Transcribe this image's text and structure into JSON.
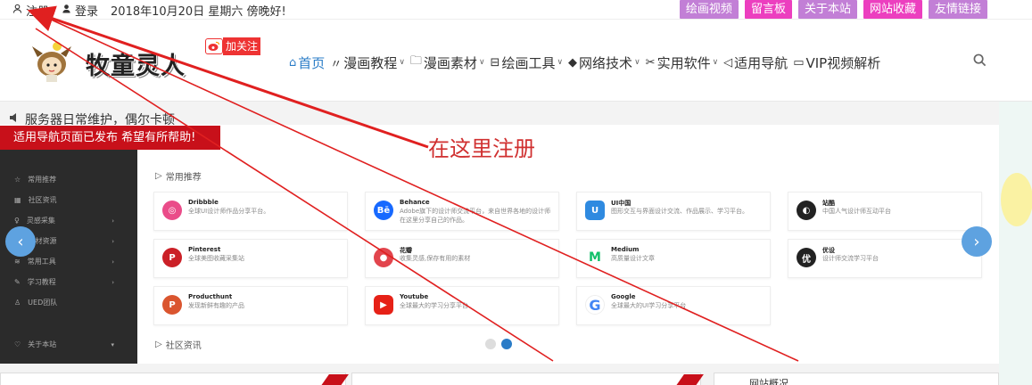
{
  "topbar": {
    "register": "注册",
    "login": "登录",
    "date": "2018年10月20日 星期六 傍晚好!",
    "links": [
      {
        "label": "绘画视频",
        "color": "#c27fd6"
      },
      {
        "label": "留言板",
        "color": "#ec3fbf"
      },
      {
        "label": "关于本站",
        "color": "#c27fd6"
      },
      {
        "label": "网站收藏",
        "color": "#ec3fbf"
      },
      {
        "label": "友情链接",
        "color": "#c27fd6"
      }
    ]
  },
  "header": {
    "logo_text": "牧童灵人",
    "weibo_follow": "加关注",
    "nav": [
      {
        "label": "首页",
        "icon": "home-icon",
        "dropdown": false,
        "active": true
      },
      {
        "label": "漫画教程",
        "icon": "brush-icon",
        "dropdown": true,
        "active": false
      },
      {
        "label": "漫画素材",
        "icon": "folder-icon",
        "dropdown": true,
        "active": false
      },
      {
        "label": "绘画工具",
        "icon": "briefcase-icon",
        "dropdown": true,
        "active": false
      },
      {
        "label": "网络技术",
        "icon": "graduation-cap-icon",
        "dropdown": true,
        "active": false
      },
      {
        "label": "实用软件",
        "icon": "scissors-icon",
        "dropdown": true,
        "active": false
      },
      {
        "label": "适用导航",
        "icon": "send-icon",
        "dropdown": false,
        "active": false
      },
      {
        "label": "VIP视频解析",
        "icon": "video-icon",
        "dropdown": false,
        "active": false
      }
    ]
  },
  "notice": "服务器日常维护，偶尔卡顿",
  "banner": {
    "red_text": "适用导航页面已发布 希望有所帮助!",
    "register_text": "在这里注册"
  },
  "sidebar": {
    "items": [
      {
        "label": "常用推荐",
        "icon": "star-icon",
        "arrow": false
      },
      {
        "label": "社区资讯",
        "icon": "news-icon",
        "arrow": false
      },
      {
        "label": "灵感采集",
        "icon": "bulb-icon",
        "arrow": true
      },
      {
        "label": "素材资源",
        "icon": "image-icon",
        "arrow": true
      },
      {
        "label": "常用工具",
        "icon": "wifi-icon",
        "arrow": true
      },
      {
        "label": "学习教程",
        "icon": "pencil-icon",
        "arrow": true
      },
      {
        "label": "UED团队",
        "icon": "user-icon",
        "arrow": false
      }
    ],
    "footer": "关于本站"
  },
  "sections": {
    "common": "常用推荐",
    "community": "社区资讯"
  },
  "cards": [
    {
      "title": "Dribbble",
      "desc": "全球UI设计师作品分享平台。",
      "color": "#ea4c89",
      "glyph": "◎"
    },
    {
      "title": "Behance",
      "desc": "Adobe旗下的设计师交流平台，来自世界各地的设计师在这里分享自己的作品。",
      "color": "#1769ff",
      "glyph": "Bē"
    },
    {
      "title": "UI中国",
      "desc": "图形交互与界面设计交流、作品展示、学习平台。",
      "color": "#2f8ae0",
      "glyph": "U"
    },
    {
      "title": "站酷",
      "desc": "中国人气设计师互动平台",
      "color": "#222222",
      "glyph": "◐"
    },
    {
      "title": "Pinterest",
      "desc": "全球美图收藏采集站",
      "color": "#cb2027",
      "glyph": "P"
    },
    {
      "title": "花瓣",
      "desc": "收集灵感,保存有用的素材",
      "color": "#e2454d",
      "glyph": "●"
    },
    {
      "title": "Medium",
      "desc": "高质量设计文章",
      "color": "#13c06a",
      "glyph": "M"
    },
    {
      "title": "优设",
      "desc": "设计师交流学习平台",
      "color": "#222222",
      "glyph": "优"
    },
    {
      "title": "Producthunt",
      "desc": "发现新鲜有趣的产品",
      "color": "#da552f",
      "glyph": "P"
    },
    {
      "title": "Youtube",
      "desc": "全球最大的学习分享平台",
      "color": "#e62117",
      "glyph": "▶"
    },
    {
      "title": "Google",
      "desc": "全球最大的UI学习分享平台",
      "color": "#4285f4",
      "glyph": "G"
    }
  ],
  "bottom": {
    "site_info": "网站概况"
  }
}
